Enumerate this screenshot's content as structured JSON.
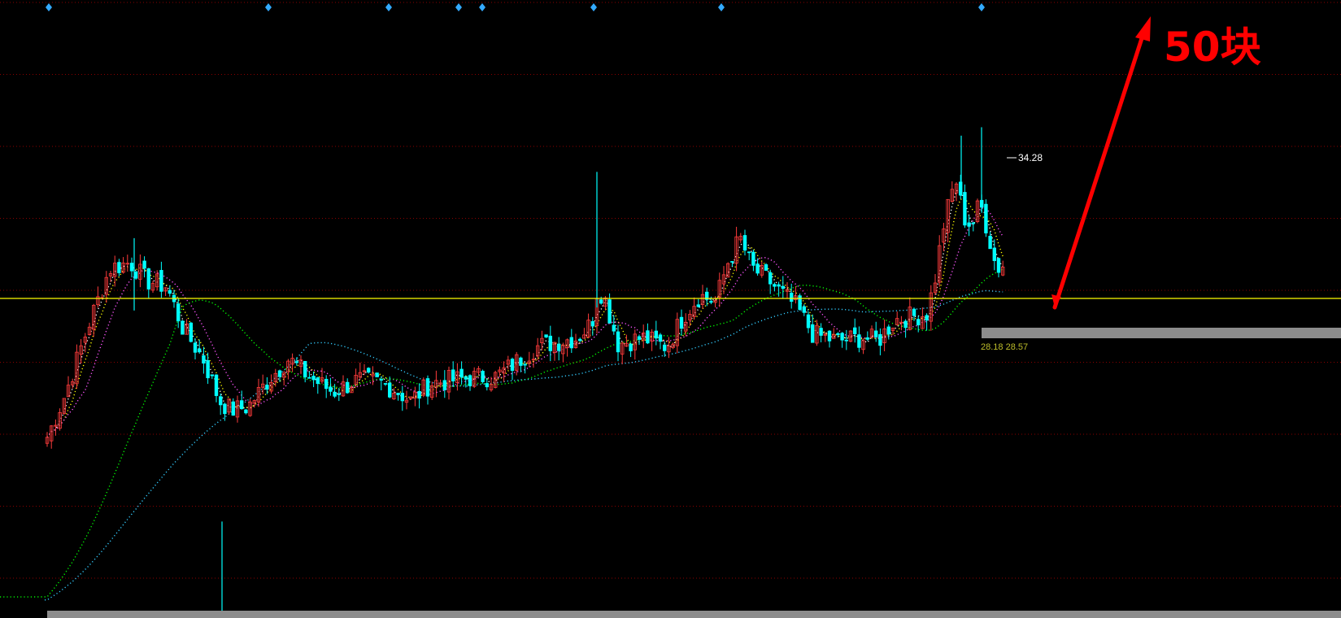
{
  "chart_data": {
    "type": "candlestick",
    "y_range": [
      18.0,
      38.5
    ],
    "up_color": "#ff3b3b",
    "down_color": "#00ffff",
    "gridline_color": "#8b0000",
    "support_line": {
      "value": 28.6,
      "color": "#ffff00"
    },
    "markers": [
      {
        "x": 60
      },
      {
        "x": 330
      },
      {
        "x": 478
      },
      {
        "x": 564
      },
      {
        "x": 593
      },
      {
        "x": 730
      },
      {
        "x": 887
      },
      {
        "x": 1207
      }
    ],
    "anchors": [
      [
        58,
        24.0
      ],
      [
        80,
        25.4
      ],
      [
        110,
        27.8
      ],
      [
        135,
        29.6
      ],
      [
        160,
        29.8
      ],
      [
        180,
        29.2
      ],
      [
        205,
        29.0
      ],
      [
        225,
        27.6
      ],
      [
        250,
        26.6
      ],
      [
        270,
        25.2
      ],
      [
        285,
        24.9
      ],
      [
        305,
        25.0
      ],
      [
        330,
        25.9
      ],
      [
        355,
        26.6
      ],
      [
        380,
        26.0
      ],
      [
        410,
        25.5
      ],
      [
        440,
        25.9
      ],
      [
        470,
        25.8
      ],
      [
        490,
        25.5
      ],
      [
        505,
        25.2
      ],
      [
        530,
        25.8
      ],
      [
        560,
        25.9
      ],
      [
        590,
        26.0
      ],
      [
        610,
        26.0
      ],
      [
        640,
        26.6
      ],
      [
        660,
        27.0
      ],
      [
        690,
        27.2
      ],
      [
        710,
        27.3
      ],
      [
        728,
        27.8
      ],
      [
        735,
        29.0
      ],
      [
        745,
        28.5
      ],
      [
        760,
        27.1
      ],
      [
        790,
        27.3
      ],
      [
        820,
        27.0
      ],
      [
        840,
        28.0
      ],
      [
        860,
        28.7
      ],
      [
        880,
        28.5
      ],
      [
        895,
        29.8
      ],
      [
        910,
        30.6
      ],
      [
        925,
        29.6
      ],
      [
        945,
        29.2
      ],
      [
        960,
        28.8
      ],
      [
        980,
        28.3
      ],
      [
        1000,
        27.4
      ],
      [
        1030,
        27.2
      ],
      [
        1060,
        27.3
      ],
      [
        1080,
        27.2
      ],
      [
        1100,
        27.9
      ],
      [
        1120,
        28.0
      ],
      [
        1140,
        28.1
      ],
      [
        1150,
        29.3
      ],
      [
        1160,
        31.0
      ],
      [
        1175,
        32.6
      ],
      [
        1185,
        31.3
      ],
      [
        1195,
        31.0
      ],
      [
        1205,
        31.8
      ],
      [
        1215,
        30.8
      ],
      [
        1225,
        29.6
      ],
      [
        1233,
        29.7
      ],
      [
        1238,
        30.0
      ]
    ],
    "ma_lines": [
      {
        "color": "#ffffff",
        "period": 5
      },
      {
        "color": "#ffff00",
        "period": 10
      },
      {
        "color": "#ff55ff",
        "period": 20
      },
      {
        "color": "#00ff00",
        "period": 60,
        "start": 0,
        "start_value": 18.7
      },
      {
        "color": "#33ccff",
        "period": 120,
        "start": 55,
        "start_value": 18.6
      }
    ],
    "annotations": {
      "high_label": "34.28",
      "high_value": 34.28,
      "ma_readout": "28.18  28.57",
      "target_label": "50块"
    },
    "target_arrow": {
      "color": "#ff0000"
    },
    "highlight_bars": {
      "color": "#8c8c8c"
    }
  }
}
